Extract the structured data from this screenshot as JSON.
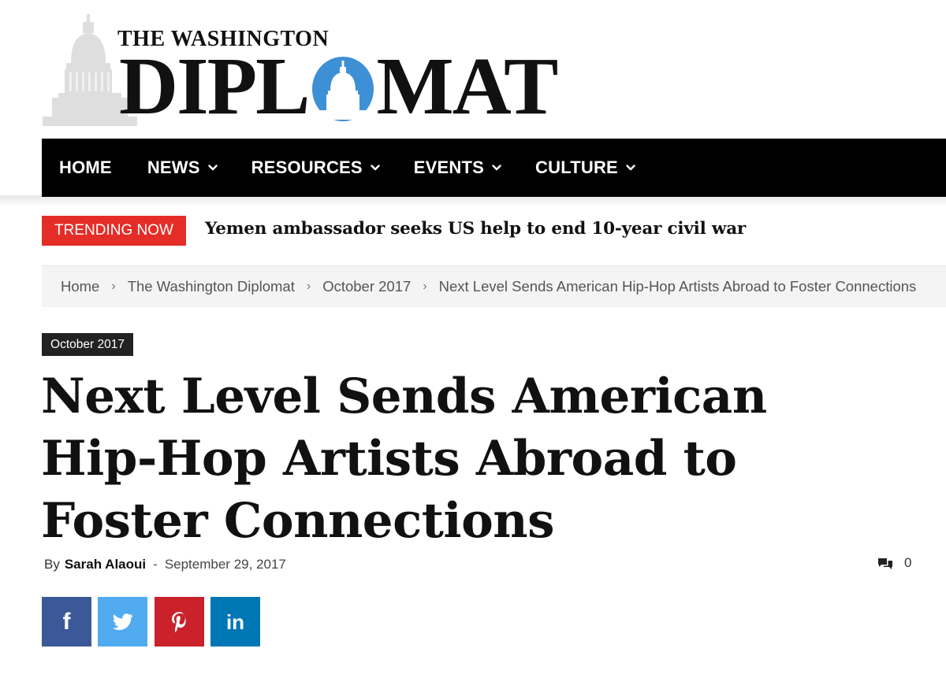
{
  "logo": {
    "top_line": "THE WASHINGTON",
    "main_left": "DIPL",
    "main_right": "MAT",
    "colors": {
      "dome_blue": "#3d8fd6",
      "capitol_grey": "#dedede"
    }
  },
  "nav": {
    "items": [
      {
        "label": "HOME",
        "dropdown": false
      },
      {
        "label": "NEWS",
        "dropdown": true
      },
      {
        "label": "RESOURCES",
        "dropdown": true
      },
      {
        "label": "EVENTS",
        "dropdown": true
      },
      {
        "label": "CULTURE",
        "dropdown": true
      }
    ]
  },
  "trending": {
    "badge": "TRENDING NOW",
    "headline": "Yemen ambassador seeks US help to end 10-year civil war",
    "color": "#e52d27"
  },
  "breadcrumb": {
    "separator": "›",
    "items": [
      "Home",
      "The Washington Diplomat",
      "October 2017",
      "Next Level Sends American Hip-Hop Artists Abroad to Foster Connections"
    ]
  },
  "article": {
    "category": "October 2017",
    "title": "Next Level Sends American Hip-Hop Artists Abroad to Foster Connections",
    "by_prefix": "By",
    "author": "Sarah Alaoui",
    "dash": "-",
    "date": "September 29, 2017",
    "comment_count": "0"
  },
  "share": [
    {
      "network": "facebook",
      "icon": "facebook-icon",
      "glyph": "f",
      "color": "#3b5998"
    },
    {
      "network": "twitter",
      "icon": "twitter-icon",
      "color": "#50abf1"
    },
    {
      "network": "pinterest",
      "icon": "pinterest-icon",
      "color": "#ca212a"
    },
    {
      "network": "linkedin",
      "icon": "linkedin-icon",
      "glyph": "in",
      "color": "#0077b5"
    }
  ]
}
